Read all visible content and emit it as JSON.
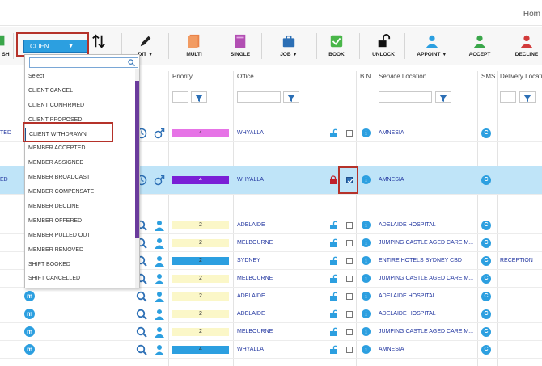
{
  "topbar": {
    "home_link": "Hom"
  },
  "toolbar": {
    "refresh_label": "SH",
    "status_select_value": "CLIEN...",
    "sort_label": "",
    "edit_label": "DIT",
    "multi_label": "MULTI",
    "single_label": "SINGLE",
    "job_label": "JOB",
    "book_label": "BOOK",
    "unlock_label": "UNLOCK",
    "appoint_label": "APPOINT",
    "accept_label": "ACCEPT",
    "decline_label": "DECLINE"
  },
  "dropdown": {
    "search_placeholder": "",
    "items": [
      "Select",
      "CLIENT CANCEL",
      "CLIENT CONFIRMED",
      "CLIENT PROPOSED",
      "CLIENT WITHDRAWN",
      "MEMBER ACCEPTED",
      "MEMBER ASSIGNED",
      "MEMBER BROADCAST",
      "MEMBER COMPENSATE",
      "MEMBER DECLINE",
      "MEMBER OFFERED",
      "MEMBER PULLED OUT",
      "MEMBER REMOVED",
      "SHIFT BOOKED",
      "SHIFT CANCELLED"
    ],
    "selected_index": 4
  },
  "table": {
    "headers": {
      "priority": "Priority",
      "office": "Office",
      "bn": "B.N",
      "service_location": "Service Location",
      "sms": "SMS",
      "delivery_location": "Delivery Locatio"
    },
    "rows": [
      {
        "left": "TED",
        "priority": "4",
        "office": "WHYALLA",
        "service": "AMNESIA",
        "delivery": "",
        "selected": false,
        "locked": false,
        "checked": false,
        "pri_color": "#e673e6",
        "icons": "clock"
      },
      {
        "left": "ED",
        "priority": "4",
        "office": "WHYALLA",
        "service": "AMNESIA",
        "delivery": "",
        "selected": true,
        "locked": true,
        "checked": true,
        "pri_color": "#7a1fd6",
        "icons": "clock"
      },
      {
        "left": "",
        "priority": "2",
        "office": "ADELAIDE",
        "service": "ADELAIDE HOSPITAL",
        "delivery": "",
        "selected": false,
        "locked": false,
        "checked": false,
        "pri_color": "#fbf7c8",
        "icons": "search"
      },
      {
        "left": "",
        "priority": "2",
        "office": "MELBOURNE",
        "service": "JUMPING CASTLE AGED CARE M...",
        "delivery": "",
        "selected": false,
        "locked": false,
        "checked": false,
        "pri_color": "#fbf7c8",
        "icons": "search"
      },
      {
        "left": "",
        "priority": "2",
        "office": "SYDNEY",
        "service": "ENTIRE HOTELS SYDNEY CBD",
        "delivery": "RECEPTION",
        "selected": false,
        "locked": false,
        "checked": false,
        "pri_color": "#2c9fe0",
        "icons": "search"
      },
      {
        "left": "",
        "priority": "2",
        "office": "MELBOURNE",
        "service": "JUMPING CASTLE AGED CARE M...",
        "delivery": "",
        "selected": false,
        "locked": false,
        "checked": false,
        "pri_color": "#fbf7c8",
        "icons": "search"
      },
      {
        "left": "",
        "priority": "2",
        "office": "ADELAIDE",
        "service": "ADELAIDE HOSPITAL",
        "delivery": "",
        "selected": false,
        "locked": false,
        "checked": false,
        "pri_color": "#fbf7c8",
        "icons": "search"
      },
      {
        "left": "",
        "priority": "2",
        "office": "ADELAIDE",
        "service": "ADELAIDE HOSPITAL",
        "delivery": "",
        "selected": false,
        "locked": false,
        "checked": false,
        "pri_color": "#fbf7c8",
        "icons": "search"
      },
      {
        "left": "",
        "priority": "2",
        "office": "MELBOURNE",
        "service": "JUMPING CASTLE AGED CARE M...",
        "delivery": "",
        "selected": false,
        "locked": false,
        "checked": false,
        "pri_color": "#fbf7c8",
        "icons": "search"
      },
      {
        "left": "",
        "priority": "4",
        "office": "WHYALLA",
        "service": "AMNESIA",
        "delivery": "",
        "selected": false,
        "locked": false,
        "checked": false,
        "pri_color": "#2c9fe0",
        "icons": "search"
      }
    ]
  },
  "colors": {
    "accent": "#2c9fe0",
    "highlight": "#b5322a",
    "selected_row": "#bfe4f8"
  }
}
